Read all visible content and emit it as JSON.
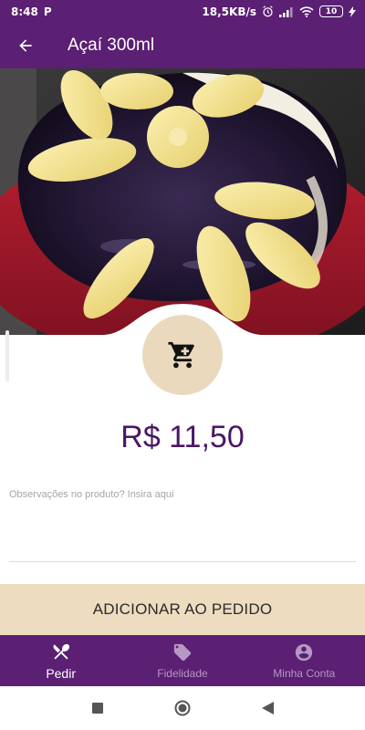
{
  "status_bar": {
    "time": "8:48",
    "app_badge": "P",
    "network_speed": "18,5KB/s",
    "battery": "10"
  },
  "app_bar": {
    "title": "Açaí 300ml",
    "back_icon": "arrow-back-icon"
  },
  "product": {
    "price": "R$ 11,50",
    "cart_icon": "shopping-cart-icon"
  },
  "notes": {
    "placeholder": "Observações no produto? Insira aqui",
    "value": ""
  },
  "add_button": {
    "label": "ADICIONAR AO PEDIDO"
  },
  "bottom_nav": {
    "items": [
      {
        "label": "Pedir",
        "icon": "utensils-icon",
        "active": true
      },
      {
        "label": "Fidelidade",
        "icon": "tag-icon",
        "active": false
      },
      {
        "label": "Minha Conta",
        "icon": "account-icon",
        "active": false
      }
    ]
  },
  "colors": {
    "primary": "#5b1f73",
    "accent_beige": "#eddcbf",
    "price_text": "#4a1763"
  }
}
